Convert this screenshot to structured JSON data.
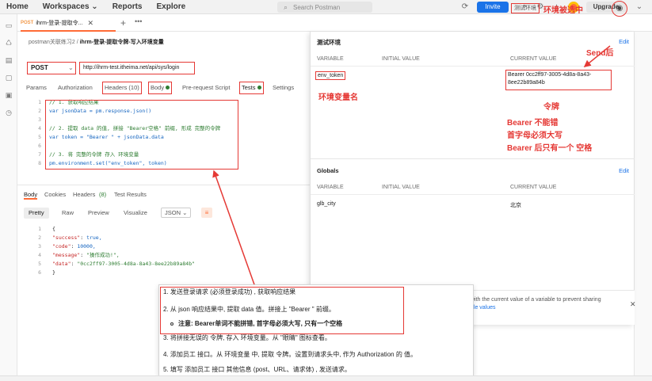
{
  "topbar": {
    "nav": [
      "Home",
      "Workspaces ⌄",
      "Reports",
      "Explore"
    ],
    "search_placeholder": "Search Postman",
    "invite_label": "Invite",
    "upgrade_label": "Upgrade"
  },
  "tab": {
    "method": "POST",
    "title": "ihrm-登录-提取令...",
    "close": "✕",
    "plus": "+",
    "more": "•••"
  },
  "environment": {
    "selected": "测试环境",
    "note": "环境被选中",
    "chevron": "⌄"
  },
  "breadcrumb": {
    "collection": "postman关联练习2",
    "separator": " / ",
    "request": "ihrm-登录-提取令牌-写入环境变量"
  },
  "request": {
    "method": "POST",
    "url": "http://ihrm-test.itheima.net/api/sys/login",
    "tabs": [
      "Params",
      "Authorization",
      "Headers (10)",
      "Body",
      "Pre-request Script",
      "Tests",
      "Settings"
    ]
  },
  "tests_code": [
    {
      "num": "1",
      "text": "// 1. 获取响应结果",
      "type": "cm"
    },
    {
      "num": "2",
      "text": "var jsonData = pm.response.json()",
      "type": "kw"
    },
    {
      "num": "3",
      "text": "",
      "type": "cm"
    },
    {
      "num": "4",
      "text": "// 2. 提取 data 的值, 拼接 \"Bearer空格\" 前缀, 形成 完整的令牌",
      "type": "cm"
    },
    {
      "num": "5",
      "text": "var token = \"Bearer \" + jsonData.data",
      "type": "kw"
    },
    {
      "num": "6",
      "text": "",
      "type": "cm"
    },
    {
      "num": "7",
      "text": "// 3. 将 完整的令牌 存入 环境变量",
      "type": "cm"
    },
    {
      "num": "8",
      "text": "pm.environment.set(\"env_token\", token)",
      "type": "kw"
    }
  ],
  "response": {
    "tabs": [
      "Body",
      "Cookies",
      "Headers",
      "(8)",
      "Test Results"
    ],
    "formats": [
      "Pretty",
      "Raw",
      "Preview",
      "Visualize",
      "JSON ⌄"
    ],
    "lines": [
      {
        "num": "1",
        "text": "{"
      },
      {
        "num": "2",
        "key": "\"success\"",
        "value": "true,"
      },
      {
        "num": "3",
        "key": "\"code\"",
        "value": "10000,"
      },
      {
        "num": "4",
        "key": "\"message\"",
        "value": "\"操作成功!\","
      },
      {
        "num": "5",
        "key": "\"data\"",
        "value": "\"0cc2ff97-3005-4d8a-8a43-8ee22b89a84b\""
      },
      {
        "num": "6",
        "text": "}"
      }
    ]
  },
  "env_panel": {
    "title": "测试环境",
    "edit": "Edit",
    "columns": [
      "VARIABLE",
      "INITIAL VALUE",
      "CURRENT VALUE"
    ],
    "rows": [
      {
        "variable": "env_token",
        "initial": "",
        "current_1": "Bearer 0cc2ff97-3005-4d8a-8a43-",
        "current_2": "8ee22b89a84b"
      }
    ],
    "globals_title": "Globals",
    "globals_edit": "Edit",
    "global_rows": [
      {
        "variable": "glb_city",
        "initial": "",
        "current": "北京"
      }
    ],
    "hint_text": "with the current value of a variable to prevent sharing",
    "hint_link": "ble values",
    "hint_close": "✕"
  },
  "annotations": {
    "send_after": "Send后",
    "env_var_name": "环境变量名",
    "token_label": "令牌",
    "rule_1": "Bearer 不能错",
    "rule_2": "首字母必须大写",
    "rule_3": "Bearer 后只有一个 空格"
  },
  "instructions": [
    "1. 发送登录请求 (必须登录成功) , 获取响应结果",
    "2. 从 json 响应结果中, 提取 data 值。拼接上 \"Bearer \" 前缀。",
    "注意: Bearer单词不能拼错, 首字母必须大写, 只有一个空格",
    "3. 将拼接无误的 令牌, 存入  环境变量。从 \"眼睛\" 图标查看。",
    "4. 添加员工 接口。从 环境变量 中, 提取 令牌。设置到请求头中, 作为 Authorization 的 值。",
    "5. 填写 添加员工 接口 其他信息 (post、URL、请求体) , 发送请求。"
  ],
  "colors": {
    "accent": "#ff6c37",
    "annotation": "#e53935",
    "link": "#1a73e8"
  }
}
